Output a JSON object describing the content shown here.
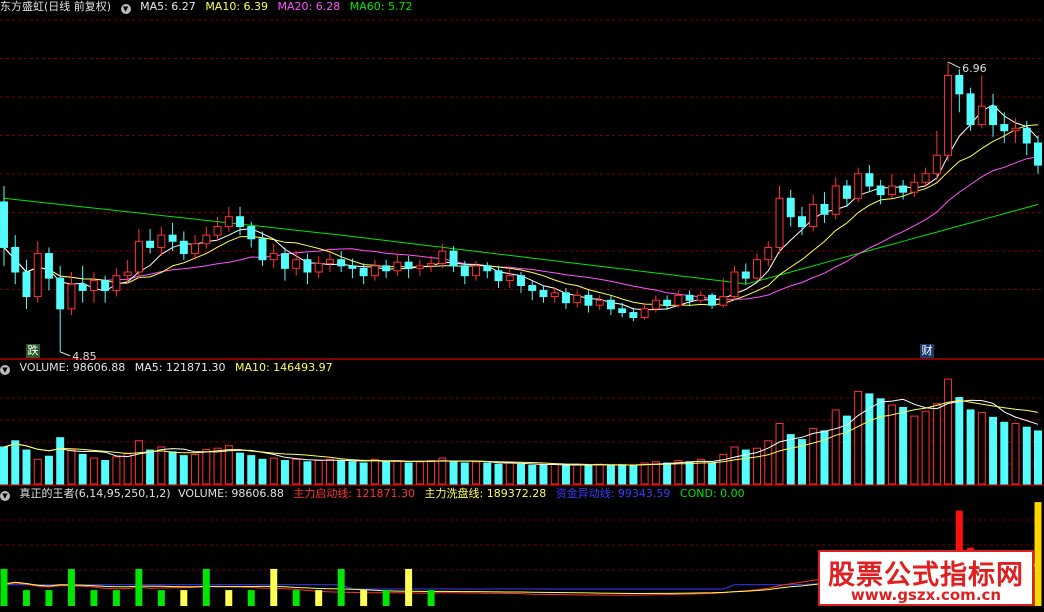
{
  "price_header": {
    "title": "东方盛虹(日线 前复权)",
    "ma5": "MA5: 6.27",
    "ma10": "MA10: 6.39",
    "ma20": "MA20: 6.28",
    "ma60": "MA60: 5.72"
  },
  "volume_header": {
    "volume": "VOLUME: 98606.88",
    "ma5": "MA5: 121871.30",
    "ma10": "MA10: 146493.97"
  },
  "indicator_header": {
    "name": "真正的王者(6,14,95,250,1,2)",
    "volume": "VOLUME: 98606.88",
    "start_line": "主力启动线: 121871.30",
    "wash_line": "主力洗盘线: 189372.28",
    "fund_line": "资金异动线: 99343.59",
    "cond": "COND: 0.00"
  },
  "annotations": {
    "high_label": "6.96",
    "low_label": "4.85",
    "mark_die": "跌",
    "mark_cai": "财"
  },
  "watermark": {
    "line1": "股票公式指标网",
    "line2": "www.gszx.com.cn"
  },
  "colors": {
    "up": "#ff3232",
    "down": "#54fcfc",
    "ma5": "#ffffff",
    "ma10": "#ffff54",
    "ma20": "#ff54ff",
    "ma60": "#00e600",
    "grid": "#7a0000",
    "divider": "#b00000"
  },
  "chart_data": {
    "type": "candlestick",
    "title": "东方盛虹(日线 前复权)",
    "price_high": 6.96,
    "price_low": 4.85,
    "candles": [
      [
        5.82,
        5.45,
        5.95,
        5.3
      ],
      [
        5.45,
        5.25,
        5.55,
        5.15
      ],
      [
        5.25,
        5.05,
        5.35,
        4.95
      ],
      [
        5.05,
        5.4,
        5.5,
        5.0
      ],
      [
        5.4,
        5.2,
        5.45,
        5.1
      ],
      [
        5.2,
        4.95,
        5.3,
        4.6
      ],
      [
        4.95,
        5.15,
        5.25,
        4.9
      ],
      [
        5.15,
        5.1,
        5.3,
        5.0
      ],
      [
        5.1,
        5.18,
        5.25,
        5.0
      ],
      [
        5.18,
        5.1,
        5.22,
        5.0
      ],
      [
        5.1,
        5.22,
        5.28,
        5.05
      ],
      [
        5.22,
        5.25,
        5.35,
        5.15
      ],
      [
        5.25,
        5.5,
        5.6,
        5.2
      ],
      [
        5.5,
        5.45,
        5.6,
        5.4
      ],
      [
        5.45,
        5.55,
        5.62,
        5.38
      ],
      [
        5.55,
        5.5,
        5.65,
        5.42
      ],
      [
        5.5,
        5.4,
        5.58,
        5.35
      ],
      [
        5.4,
        5.48,
        5.55,
        5.35
      ],
      [
        5.48,
        5.55,
        5.62,
        5.44
      ],
      [
        5.55,
        5.62,
        5.7,
        5.5
      ],
      [
        5.62,
        5.7,
        5.78,
        5.58
      ],
      [
        5.7,
        5.62,
        5.78,
        5.55
      ],
      [
        5.62,
        5.52,
        5.66,
        5.45
      ],
      [
        5.52,
        5.35,
        5.58,
        5.3
      ],
      [
        5.35,
        5.4,
        5.48,
        5.28
      ],
      [
        5.4,
        5.28,
        5.45,
        5.18
      ],
      [
        5.28,
        5.35,
        5.42,
        5.22
      ],
      [
        5.35,
        5.25,
        5.4,
        5.15
      ],
      [
        5.25,
        5.32,
        5.38,
        5.2
      ],
      [
        5.32,
        5.35,
        5.4,
        5.25
      ],
      [
        5.35,
        5.3,
        5.42,
        5.25
      ],
      [
        5.3,
        5.28,
        5.36,
        5.2
      ],
      [
        5.28,
        5.22,
        5.32,
        5.15
      ],
      [
        5.22,
        5.3,
        5.35,
        5.18
      ],
      [
        5.3,
        5.26,
        5.35,
        5.2
      ],
      [
        5.26,
        5.33,
        5.4,
        5.22
      ],
      [
        5.33,
        5.28,
        5.38,
        5.2
      ],
      [
        5.28,
        5.3,
        5.35,
        5.22
      ],
      [
        5.3,
        5.32,
        5.38,
        5.25
      ],
      [
        5.32,
        5.42,
        5.48,
        5.28
      ],
      [
        5.42,
        5.3,
        5.46,
        5.25
      ],
      [
        5.3,
        5.22,
        5.34,
        5.15
      ],
      [
        5.22,
        5.3,
        5.34,
        5.18
      ],
      [
        5.3,
        5.26,
        5.33,
        5.2
      ],
      [
        5.26,
        5.18,
        5.3,
        5.12
      ],
      [
        5.18,
        5.22,
        5.28,
        5.12
      ],
      [
        5.22,
        5.14,
        5.25,
        5.08
      ],
      [
        5.14,
        5.1,
        5.18,
        5.02
      ],
      [
        5.1,
        5.05,
        5.14,
        5.0
      ],
      [
        5.05,
        5.08,
        5.12,
        5.0
      ],
      [
        5.08,
        5.0,
        5.12,
        4.95
      ],
      [
        5.0,
        5.06,
        5.1,
        4.96
      ],
      [
        5.06,
        4.98,
        5.1,
        4.92
      ],
      [
        4.98,
        5.02,
        5.06,
        4.94
      ],
      [
        5.02,
        4.95,
        5.06,
        4.9
      ],
      [
        4.95,
        4.92,
        5.0,
        4.88
      ],
      [
        4.92,
        4.88,
        4.96,
        4.85
      ],
      [
        4.88,
        4.95,
        5.0,
        4.86
      ],
      [
        4.95,
        5.02,
        5.06,
        4.92
      ],
      [
        5.02,
        4.98,
        5.06,
        4.94
      ],
      [
        4.98,
        5.06,
        5.1,
        4.96
      ],
      [
        5.06,
        5.02,
        5.1,
        4.98
      ],
      [
        5.02,
        5.06,
        5.1,
        5.0
      ],
      [
        5.06,
        4.98,
        5.08,
        4.95
      ],
      [
        4.98,
        5.05,
        5.2,
        4.96
      ],
      [
        5.05,
        5.25,
        5.3,
        5.02
      ],
      [
        5.25,
        5.2,
        5.32,
        5.15
      ],
      [
        5.2,
        5.35,
        5.4,
        5.18
      ],
      [
        5.35,
        5.45,
        5.5,
        5.3
      ],
      [
        5.45,
        5.85,
        5.95,
        5.4
      ],
      [
        5.85,
        5.7,
        5.92,
        5.62
      ],
      [
        5.7,
        5.62,
        5.78,
        5.55
      ],
      [
        5.62,
        5.8,
        5.88,
        5.58
      ],
      [
        5.8,
        5.72,
        5.9,
        5.65
      ],
      [
        5.72,
        5.95,
        6.02,
        5.68
      ],
      [
        5.95,
        5.85,
        6.0,
        5.78
      ],
      [
        5.85,
        6.05,
        6.1,
        5.82
      ],
      [
        6.05,
        5.95,
        6.12,
        5.9
      ],
      [
        5.95,
        5.88,
        6.0,
        5.8
      ],
      [
        5.88,
        5.95,
        6.05,
        5.85
      ],
      [
        5.95,
        5.9,
        6.0,
        5.84
      ],
      [
        5.9,
        5.98,
        6.05,
        5.86
      ],
      [
        5.98,
        6.05,
        6.1,
        5.94
      ],
      [
        6.05,
        6.2,
        6.4,
        6.0
      ],
      [
        6.2,
        6.85,
        6.96,
        6.15
      ],
      [
        6.85,
        6.7,
        6.9,
        6.55
      ],
      [
        6.7,
        6.45,
        6.75,
        6.4
      ],
      [
        6.45,
        6.6,
        6.85,
        6.42
      ],
      [
        6.6,
        6.45,
        6.7,
        6.35
      ],
      [
        6.45,
        6.4,
        6.55,
        6.3
      ],
      [
        6.4,
        6.42,
        6.5,
        6.3
      ],
      [
        6.42,
        6.3,
        6.48,
        6.2
      ],
      [
        6.3,
        6.12,
        6.36,
        6.05
      ]
    ],
    "volume": [
      60,
      70,
      55,
      40,
      45,
      75,
      55,
      48,
      42,
      38,
      44,
      50,
      70,
      55,
      60,
      52,
      46,
      48,
      56,
      58,
      62,
      50,
      46,
      40,
      42,
      38,
      40,
      36,
      38,
      40,
      38,
      36,
      34,
      40,
      36,
      38,
      34,
      36,
      38,
      42,
      36,
      34,
      36,
      34,
      32,
      34,
      32,
      30,
      30,
      32,
      30,
      32,
      30,
      32,
      30,
      31,
      30,
      34,
      36,
      34,
      38,
      36,
      40,
      34,
      48,
      60,
      55,
      58,
      70,
      98,
      80,
      72,
      90,
      86,
      120,
      110,
      150,
      146,
      138,
      128,
      124,
      110,
      118,
      130,
      170,
      140,
      120,
      116,
      108,
      100,
      98,
      92,
      86
    ],
    "volume_max": 230000,
    "indicator": {
      "cond_markers": [
        {
          "index": 83,
          "value": 0.4,
          "color": "red"
        },
        {
          "index": 85,
          "value": 0.9,
          "color": "red"
        },
        {
          "index": 86,
          "value": 0.55,
          "color": "red"
        },
        {
          "index": 87,
          "value": 0.5,
          "color": "red"
        },
        {
          "index": 88,
          "value": 0.45,
          "color": "red"
        },
        {
          "index": 90,
          "value": 0.42,
          "color": "red"
        },
        {
          "index": 91,
          "value": 0.35,
          "color": "red"
        },
        {
          "index": 101,
          "value": 0.98,
          "color": "yellow"
        },
        {
          "index": 103,
          "value": 0.9,
          "color": "yellow"
        }
      ]
    }
  }
}
